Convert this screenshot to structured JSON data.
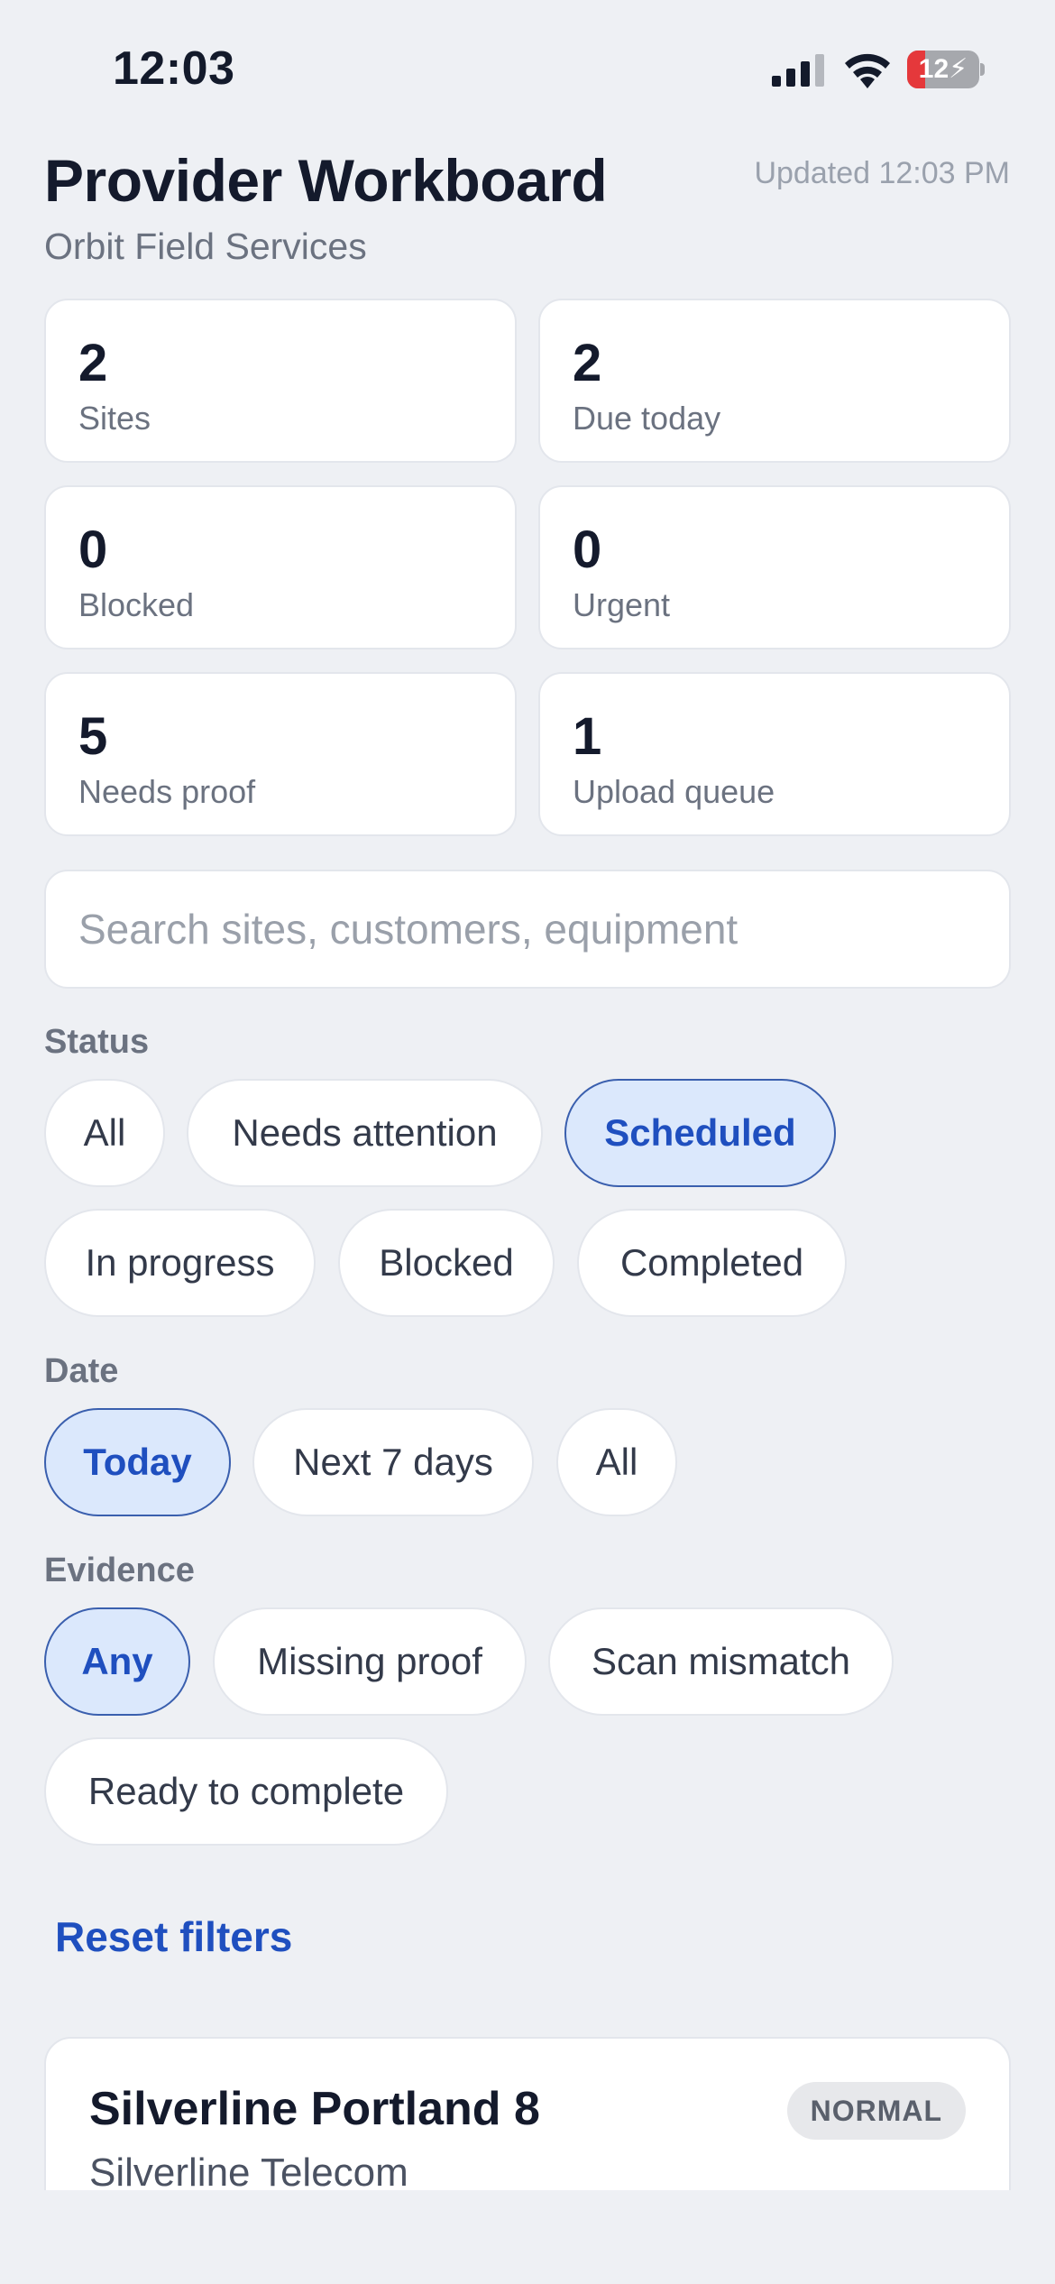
{
  "status_bar": {
    "time": "12:03",
    "battery_level": "12",
    "battery_fraction": 0.12,
    "battery_color": "#e5383b",
    "signal_icon": "cellular-signal-icon",
    "wifi_icon": "wifi-icon",
    "battery_icon": "battery-charging-icon"
  },
  "header": {
    "title": "Provider Workboard",
    "subtitle": "Orbit Field Services",
    "updated": "Updated 12:03 PM"
  },
  "stats": [
    {
      "value": "2",
      "label": "Sites"
    },
    {
      "value": "2",
      "label": "Due today"
    },
    {
      "value": "0",
      "label": "Blocked"
    },
    {
      "value": "0",
      "label": "Urgent"
    },
    {
      "value": "5",
      "label": "Needs proof"
    },
    {
      "value": "1",
      "label": "Upload queue"
    }
  ],
  "search": {
    "placeholder": "Search sites, customers, equipment",
    "value": ""
  },
  "filters": {
    "status": {
      "label": "Status",
      "options": [
        "All",
        "Needs attention",
        "Scheduled",
        "In progress",
        "Blocked",
        "Completed"
      ],
      "selected": "Scheduled"
    },
    "date": {
      "label": "Date",
      "options": [
        "Today",
        "Next 7 days",
        "All"
      ],
      "selected": "Today"
    },
    "evidence": {
      "label": "Evidence",
      "options": [
        "Any",
        "Missing proof",
        "Scan mismatch",
        "Ready to complete"
      ],
      "selected": "Any"
    }
  },
  "reset_label": "Reset filters",
  "sites": [
    {
      "name": "Silverline Portland 8",
      "customer": "Silverline Telecom",
      "priority": "NORMAL"
    }
  ],
  "colors": {
    "background": "#eef0f4",
    "accent": "#1f4fbf",
    "chip_active_bg": "#dbe8fc"
  }
}
